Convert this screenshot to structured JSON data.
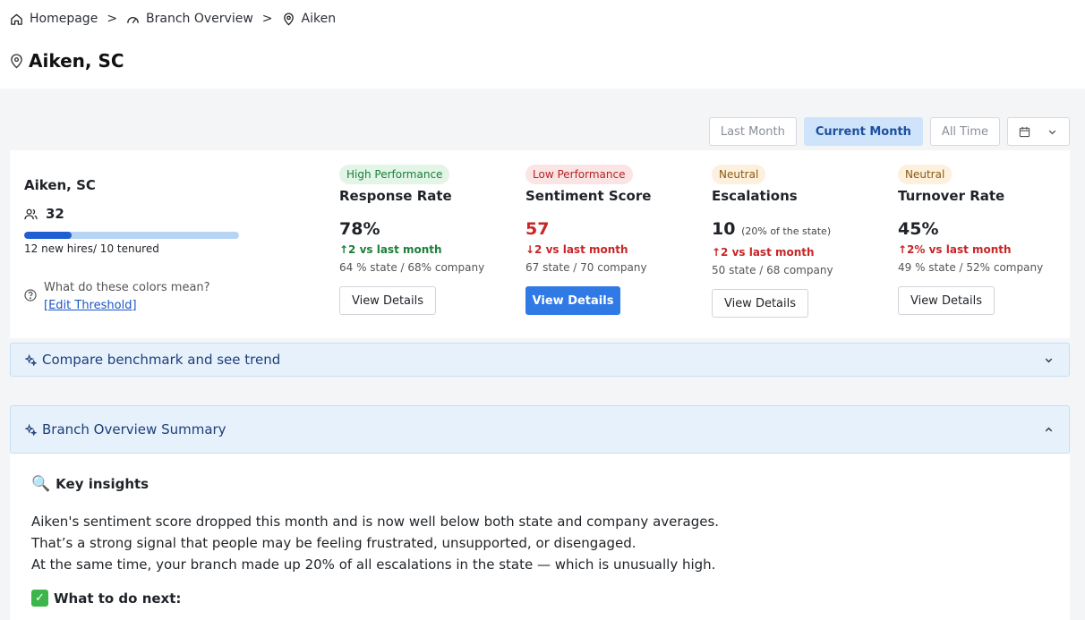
{
  "breadcrumb": {
    "home": "Homepage",
    "overview": "Branch Overview",
    "current": "Aiken",
    "separator": ">"
  },
  "page_title": "Aiken, SC",
  "filters": {
    "last_month": "Last Month",
    "current_month": "Current Month",
    "all_time": "All Time",
    "active": "Current Month"
  },
  "branch": {
    "name": "Aiken, SC",
    "headcount": "32",
    "new_hires_fraction": 0.22,
    "hires_text": "12 new hires/ 10 tenured",
    "help_question": "What do these colors mean?",
    "edit_threshold": "[Edit Threshold]"
  },
  "metrics": [
    {
      "tag": "High Performance",
      "name": "Response Rate",
      "value": "78%",
      "value_sub": "",
      "delta": "↑2 vs last month",
      "bench": "64 % state / 68% company",
      "button": "View Details"
    },
    {
      "tag": "Low Performance",
      "name": "Sentiment Score",
      "value": "57",
      "value_sub": "",
      "delta": "↓2 vs last month",
      "bench": "67 state / 70 company",
      "button": "View Details"
    },
    {
      "tag": "Neutral",
      "name": "Escalations",
      "value": "10",
      "value_sub": "(20% of the state)",
      "delta": "↑2 vs last month",
      "bench": "50 state / 68 company",
      "button": "View Details"
    },
    {
      "tag": "Neutral",
      "name": "Turnover Rate",
      "value": "45%",
      "value_sub": "",
      "delta": "↑2% vs last month",
      "bench": "49 % state / 52% company",
      "button": "View Details"
    }
  ],
  "compare_label": "Compare benchmark and see trend",
  "summary": {
    "header": "Branch Overview Summary",
    "key_insights_icon": "🔍",
    "key_insights_title": "Key insights",
    "lines": [
      "Aiken's sentiment score dropped this month and is now well below both state and company averages.",
      "That’s a strong signal that people may be feeling frustrated, unsupported, or disengaged.",
      "At the same time, your branch made up 20% of all escalations in the state — which is unusually high."
    ],
    "next_icon": "✓",
    "next_title": "What to do next:"
  },
  "colors": {
    "accent": "#2f7ae5",
    "good": "#1b7f3a",
    "bad": "#c62626",
    "neutral_tag": "#8a5a12"
  }
}
